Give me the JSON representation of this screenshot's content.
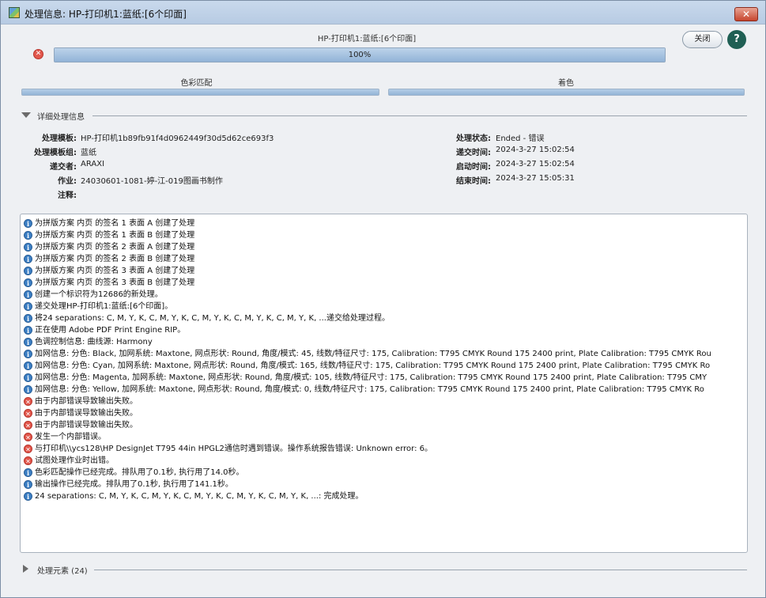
{
  "window": {
    "title": "处理信息: HP-打印机1:蓝纸:[6个印面]",
    "close_glyph": "✕"
  },
  "header": {
    "job_title": "HP-打印机1:蓝纸:[6个印面]",
    "progress_label": "100%",
    "progress": 1.0,
    "close_button": "关闭",
    "help_button": "?"
  },
  "stages": [
    {
      "label": "色彩匹配"
    },
    {
      "label": "着色"
    }
  ],
  "details": {
    "section_label": "详细处理信息",
    "left": [
      {
        "label": "处理模板:",
        "value": "HP-打印机1b89fb91f4d0962449f30d5d62ce693f3"
      },
      {
        "label": "处理模板组:",
        "value": "蓝纸"
      },
      {
        "label": "递交者:",
        "value": "ARAXI"
      },
      {
        "label": "作业:",
        "value": "24030601-1081-婷-江-019图画书制作"
      },
      {
        "label": "注释:",
        "value": ""
      }
    ],
    "right": [
      {
        "label": "处理状态:",
        "value": "Ended - 错误"
      },
      {
        "label": "递交时间:",
        "value": "2024-3-27 15:02:54"
      },
      {
        "label": "启动时间:",
        "value": "2024-3-27 15:02:54"
      },
      {
        "label": "结束时间:",
        "value": "2024-3-27 15:05:31"
      }
    ]
  },
  "log": [
    {
      "type": "info",
      "text": "为拼版方案 内页 的签名 1 表面 A 创建了处理"
    },
    {
      "type": "info",
      "text": "为拼版方案 内页 的签名 1 表面 B 创建了处理"
    },
    {
      "type": "info",
      "text": "为拼版方案 内页 的签名 2 表面 A 创建了处理"
    },
    {
      "type": "info",
      "text": "为拼版方案 内页 的签名 2 表面 B 创建了处理"
    },
    {
      "type": "info",
      "text": "为拼版方案 内页 的签名 3 表面 A 创建了处理"
    },
    {
      "type": "info",
      "text": "为拼版方案 内页 的签名 3 表面 B 创建了处理"
    },
    {
      "type": "info",
      "text": "创建一个标识符为12686的新处理。"
    },
    {
      "type": "info",
      "text": "递交处理HP-打印机1:蓝纸:[6个印面]。"
    },
    {
      "type": "info",
      "text": "将24 separations: C, M, Y, K, C, M, Y, K, C, M, Y, K, C, M, Y, K, C, M, Y, K, ...递交给处理过程。"
    },
    {
      "type": "info",
      "text": "正在使用 Adobe PDF Print Engine RIP。"
    },
    {
      "type": "info",
      "text": "色调控制信息: 曲线源: Harmony"
    },
    {
      "type": "info",
      "text": "加网信息: 分色: Black, 加网系统: Maxtone, 网点形状: Round, 角度/模式: 45, 线数/特征尺寸: 175, Calibration: T795 CMYK Round 175 2400 print, Plate Calibration: T795 CMYK Rou"
    },
    {
      "type": "info",
      "text": "加网信息: 分色: Cyan, 加网系统: Maxtone, 网点形状: Round, 角度/模式: 165, 线数/特征尺寸: 175, Calibration: T795 CMYK Round 175 2400 print, Plate Calibration: T795 CMYK Ro"
    },
    {
      "type": "info",
      "text": "加网信息: 分色: Magenta, 加网系统: Maxtone, 网点形状: Round, 角度/模式: 105, 线数/特征尺寸: 175, Calibration: T795 CMYK Round 175 2400 print, Plate Calibration: T795 CMY"
    },
    {
      "type": "info",
      "text": "加网信息: 分色: Yellow, 加网系统: Maxtone, 网点形状: Round, 角度/模式: 0, 线数/特征尺寸: 175, Calibration: T795 CMYK Round 175 2400 print, Plate Calibration: T795 CMYK Ro"
    },
    {
      "type": "error",
      "text": "由于内部错误导致输出失败。"
    },
    {
      "type": "error",
      "text": "由于内部错误导致输出失败。"
    },
    {
      "type": "error",
      "text": "由于内部错误导致输出失败。"
    },
    {
      "type": "error",
      "text": "发生一个内部错误。"
    },
    {
      "type": "error",
      "text": "与打印机\\\\ycs128\\HP DesignJet T795 44in HPGL2通信时遇到错误。操作系统报告错误: Unknown error: 6。"
    },
    {
      "type": "error",
      "text": "试图处理作业时出错。"
    },
    {
      "type": "info",
      "text": "色彩匹配操作已经完成。排队用了0.1秒, 执行用了14.0秒。"
    },
    {
      "type": "info",
      "text": "输出操作已经完成。排队用了0.1秒, 执行用了141.1秒。"
    },
    {
      "type": "info",
      "text": "24 separations: C, M, Y, K, C, M, Y, K, C, M, Y, K, C, M, Y, K, C, M, Y, K, ...: 完成处理。"
    }
  ],
  "elements": {
    "section_label": "处理元素 (24)"
  },
  "icons": {
    "info": "i",
    "error": "✕"
  },
  "colors": {
    "progress": "#92b3d7",
    "error": "#e2574c",
    "info": "#3c7fc4",
    "help": "#1f5f54"
  }
}
